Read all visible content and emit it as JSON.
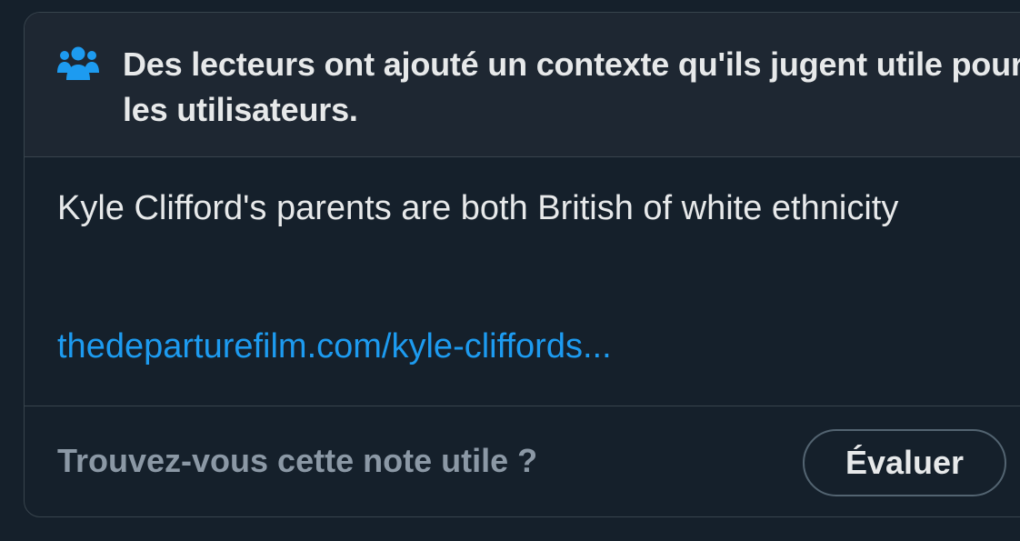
{
  "header": {
    "icon": "people-icon",
    "title": "Des lecteurs ont ajouté un contexte qu'ils jugent utile pour les utilisateurs."
  },
  "note": {
    "text": "Kyle Clifford's parents are both British of white ethnicity",
    "link": "thedeparturefilm.com/kyle-cliffords..."
  },
  "footer": {
    "question": "Trouvez-vous cette note utile ?",
    "rate_label": "Évaluer"
  },
  "colors": {
    "background": "#15202b",
    "header_background": "#1e2732",
    "border": "#38444d",
    "accent": "#1d9bf0",
    "text": "#e7e9ea",
    "muted_text": "#8b98a5"
  }
}
